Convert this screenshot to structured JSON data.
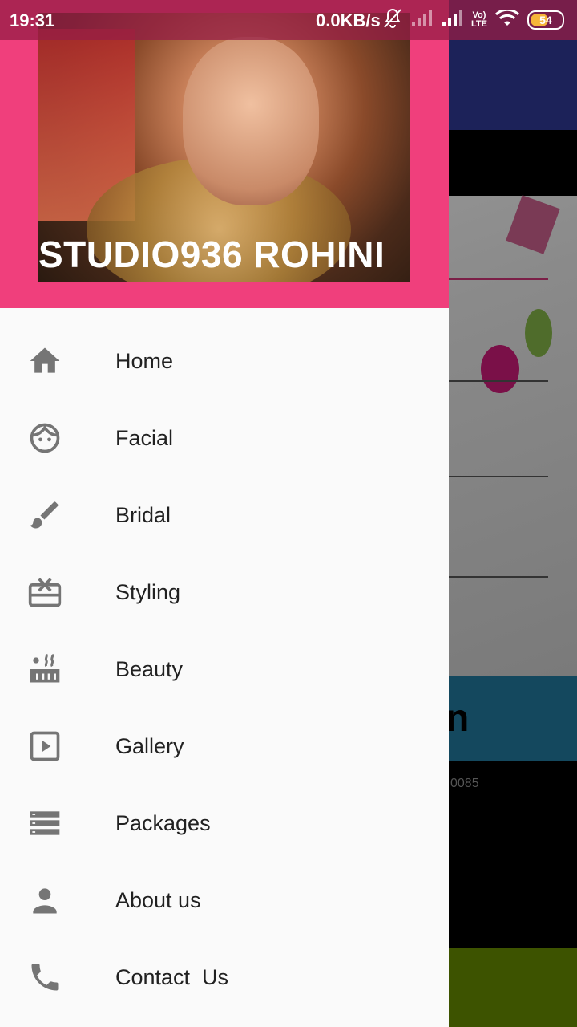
{
  "status_bar": {
    "time": "19:31",
    "network_speed": "0.0KB/s",
    "volte": "Vo)",
    "lte": "LTE",
    "battery": "54"
  },
  "drawer": {
    "title": "STUDIO936 ROHINI",
    "menu": [
      {
        "label": "Home",
        "icon": "home-icon"
      },
      {
        "label": "Facial",
        "icon": "face-icon"
      },
      {
        "label": "Bridal",
        "icon": "brush-icon"
      },
      {
        "label": "Styling",
        "icon": "card-giftcard-icon"
      },
      {
        "label": "Beauty",
        "icon": "hot-tub-icon"
      },
      {
        "label": "Gallery",
        "icon": "play-box-icon"
      },
      {
        "label": "Packages",
        "icon": "storage-icon"
      },
      {
        "label": "About us",
        "icon": "person-icon"
      },
      {
        "label": "Contact  Us",
        "icon": "phone-icon"
      }
    ]
  },
  "background": {
    "band_text": "n",
    "phone_fragment": "0085"
  },
  "colors": {
    "header": "#f03f7c",
    "drawer": "#fafafa",
    "icon": "#757575",
    "text": "#212121"
  }
}
